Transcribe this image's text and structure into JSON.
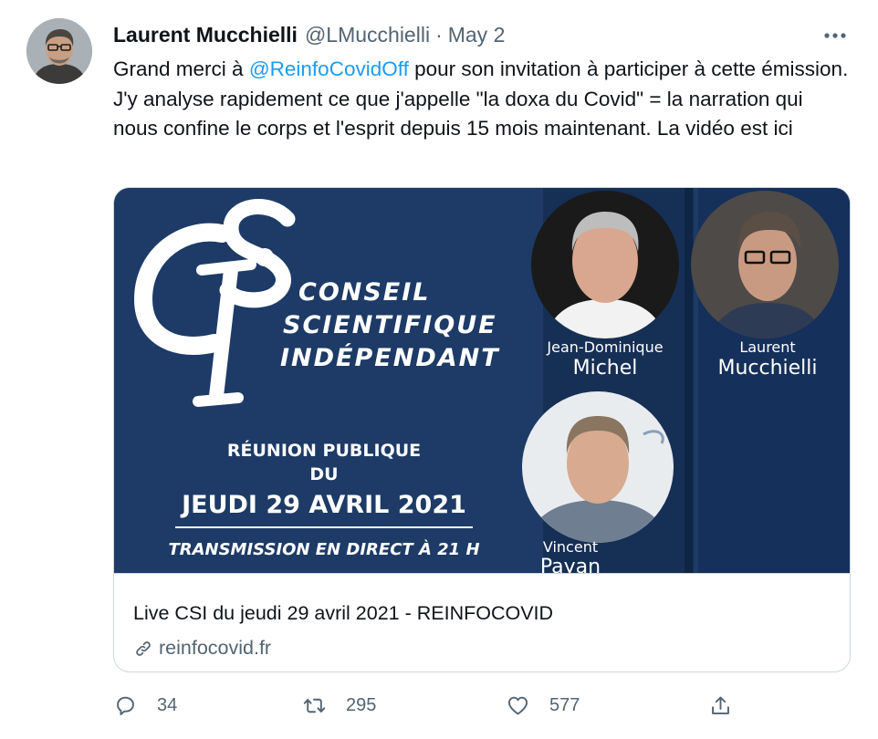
{
  "author": {
    "name": "Laurent Mucchielli",
    "handle": "@LMucchielli",
    "separator": "·",
    "date": "May 2"
  },
  "tweet": {
    "text_before": "Grand merci à ",
    "mention": "@ReinfoCovidOff",
    "text_after": " pour son invitation à participer à cette émission. J'y analyse rapidement ce que j'appelle \"la doxa du Covid\" = la narration qui nous confine le corps et l'esprit depuis 15 mois maintenant. La vidéo est ici"
  },
  "card": {
    "title": "Live CSI du jeudi 29 avril 2021 - REINFOCOVID",
    "domain": "reinfocovid.fr",
    "image": {
      "logo_letters": "CSI",
      "line1": "CONSEIL",
      "line2": "SCIENTIFIQUE",
      "line3": "INDÉPENDANT",
      "meeting": "RÉUNION PUBLIQUE",
      "du": "DU",
      "date": "JEUDI 29 AVRIL 2021",
      "broadcast": "TRANSMISSION EN DIRECT À 21 H",
      "person1_first": "Jean-Dominique",
      "person1_last": "Michel",
      "person2_first": "Laurent",
      "person2_last": "Mucchielli",
      "person3_first": "Vincent",
      "person3_last": "Payan"
    }
  },
  "actions": {
    "replies": "34",
    "retweets": "295",
    "likes": "577"
  },
  "colors": {
    "accent": "#1d9bf0",
    "secondary_text": "#536471",
    "banner_bg": "#1d3b66"
  },
  "icons": [
    "more-icon",
    "reply-icon",
    "retweet-icon",
    "like-icon",
    "share-icon",
    "link-icon"
  ]
}
